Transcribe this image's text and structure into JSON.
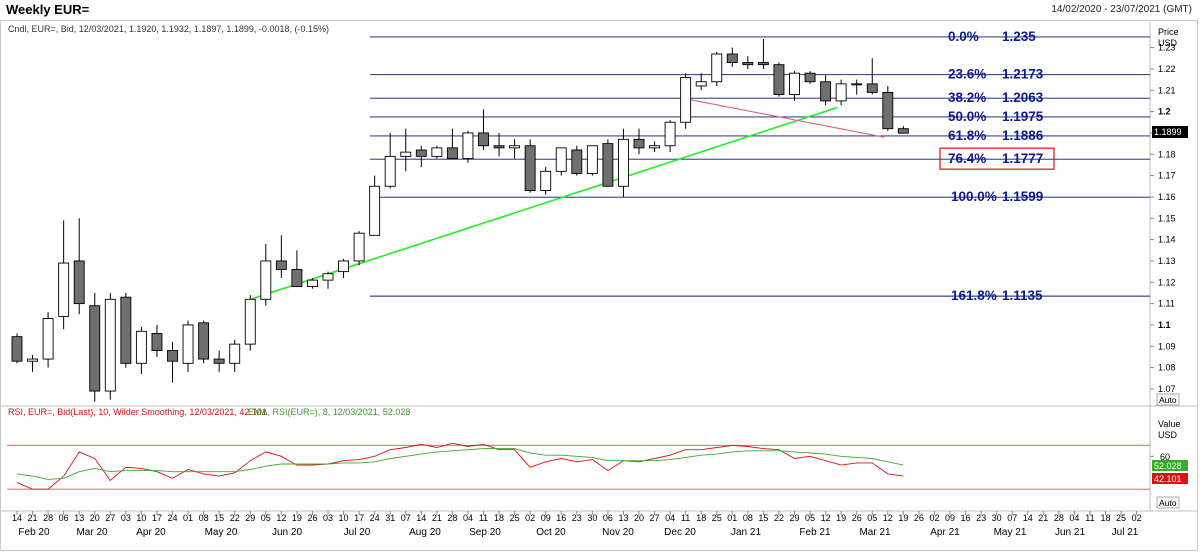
{
  "header": {
    "title": "Weekly EUR=",
    "date_range": "14/02/2020 - 23/07/2021 (GMT)"
  },
  "price_panel": {
    "legend": "Cndl, EUR=, Bid, 12/03/2021, 1.1920, 1.1932, 1.1897, 1.1899, -0.0018, (-0.15%)",
    "axis_title_1": "Price",
    "axis_title_2": "USD",
    "last_price_label": "1.1899",
    "auto_label": "Auto"
  },
  "rsi_panel": {
    "legend_rsi": "RSI, EUR=, Bid(Last),  10, Wilder Smoothing, 12/03/2021, 42.101",
    "legend_ema": "EMA, RSI(EUR=),  8, 12/03/2021, 52.028",
    "axis_title_1": "Value",
    "axis_title_2": "USD",
    "tick_60": "60",
    "ema_value_label": "52.028",
    "rsi_value_label": "42.101",
    "auto_label": "Auto"
  },
  "colors": {
    "up_body": "#ffffff",
    "down_body": "#6f6f6f",
    "fib_line": "#0a1470",
    "fib_label": "#0d1a8c",
    "trendline": "#22ee22",
    "downtrend": "#e0607a",
    "rsi_line": "#e01010",
    "ema_line": "#3caa2a",
    "highlight_box": "#e01010"
  },
  "chart_data": [
    {
      "type": "candlestick",
      "title": "Weekly EUR=",
      "ylabel": "Price USD",
      "ylim": [
        1.062,
        1.242
      ],
      "y_ticks": [
        1.07,
        1.08,
        1.09,
        1.1,
        1.11,
        1.12,
        1.13,
        1.14,
        1.15,
        1.16,
        1.17,
        1.18,
        1.19,
        1.2,
        1.21,
        1.22,
        1.23
      ],
      "y_tick_labels": [
        "1.07",
        "1.08",
        "1.09",
        "1.1",
        "1.11",
        "1.12",
        "1.13",
        "1.14",
        "1.15",
        "1.16",
        "1.17",
        "1.18",
        "1.19",
        "1.2",
        "1.21",
        "1.22",
        "1.23"
      ],
      "x_ticks": [
        "14",
        "21",
        "28",
        "06",
        "13",
        "20",
        "27",
        "03",
        "10",
        "17",
        "24",
        "01",
        "08",
        "15",
        "22",
        "29",
        "05",
        "12",
        "19",
        "26",
        "03",
        "10",
        "17",
        "24",
        "31",
        "07",
        "14",
        "21",
        "28",
        "04",
        "11",
        "18",
        "25",
        "02",
        "09",
        "16",
        "23",
        "30",
        "06",
        "13",
        "20",
        "27",
        "04",
        "11",
        "18",
        "25",
        "01",
        "08",
        "15",
        "22",
        "29",
        "05",
        "12",
        "19",
        "26",
        "05",
        "12",
        "19",
        "26",
        "02",
        "09",
        "16",
        "23",
        "30",
        "07",
        "14",
        "21",
        "28",
        "04",
        "11",
        "18",
        "25",
        "02",
        "09",
        "16",
        "23"
      ],
      "month_labels": [
        "Feb 20",
        "Mar 20",
        "Apr 20",
        "May 20",
        "Jun 20",
        "Jul 20",
        "Aug 20",
        "Sep 20",
        "Oct 20",
        "Nov 20",
        "Dec 20",
        "Jan 21",
        "Feb 21",
        "Mar 21",
        "Apr 21",
        "May 21",
        "Jun 21",
        "Jul 21"
      ],
      "candles": [
        {
          "o": 1.0945,
          "h": 1.096,
          "l": 1.082,
          "c": 1.083
        },
        {
          "o": 1.083,
          "h": 1.086,
          "l": 1.078,
          "c": 1.084
        },
        {
          "o": 1.084,
          "h": 1.106,
          "l": 1.08,
          "c": 1.103
        },
        {
          "o": 1.104,
          "h": 1.149,
          "l": 1.098,
          "c": 1.129
        },
        {
          "o": 1.13,
          "h": 1.15,
          "l": 1.105,
          "c": 1.11
        },
        {
          "o": 1.109,
          "h": 1.115,
          "l": 1.064,
          "c": 1.069
        },
        {
          "o": 1.069,
          "h": 1.115,
          "l": 1.065,
          "c": 1.112
        },
        {
          "o": 1.113,
          "h": 1.115,
          "l": 1.08,
          "c": 1.082
        },
        {
          "o": 1.082,
          "h": 1.099,
          "l": 1.077,
          "c": 1.097
        },
        {
          "o": 1.096,
          "h": 1.1,
          "l": 1.085,
          "c": 1.088
        },
        {
          "o": 1.088,
          "h": 1.092,
          "l": 1.073,
          "c": 1.083
        },
        {
          "o": 1.082,
          "h": 1.102,
          "l": 1.078,
          "c": 1.1
        },
        {
          "o": 1.101,
          "h": 1.102,
          "l": 1.082,
          "c": 1.084
        },
        {
          "o": 1.084,
          "h": 1.088,
          "l": 1.078,
          "c": 1.082
        },
        {
          "o": 1.082,
          "h": 1.093,
          "l": 1.078,
          "c": 1.091
        },
        {
          "o": 1.091,
          "h": 1.114,
          "l": 1.088,
          "c": 1.112
        },
        {
          "o": 1.112,
          "h": 1.138,
          "l": 1.109,
          "c": 1.13
        },
        {
          "o": 1.13,
          "h": 1.142,
          "l": 1.122,
          "c": 1.126
        },
        {
          "o": 1.126,
          "h": 1.135,
          "l": 1.118,
          "c": 1.118
        },
        {
          "o": 1.118,
          "h": 1.122,
          "l": 1.117,
          "c": 1.121
        },
        {
          "o": 1.121,
          "h": 1.125,
          "l": 1.117,
          "c": 1.124
        },
        {
          "o": 1.125,
          "h": 1.131,
          "l": 1.122,
          "c": 1.13
        },
        {
          "o": 1.13,
          "h": 1.144,
          "l": 1.128,
          "c": 1.143
        },
        {
          "o": 1.142,
          "h": 1.17,
          "l": 1.142,
          "c": 1.165
        },
        {
          "o": 1.165,
          "h": 1.19,
          "l": 1.164,
          "c": 1.179
        },
        {
          "o": 1.179,
          "h": 1.192,
          "l": 1.172,
          "c": 1.181
        },
        {
          "o": 1.182,
          "h": 1.184,
          "l": 1.174,
          "c": 1.179
        },
        {
          "o": 1.179,
          "h": 1.184,
          "l": 1.178,
          "c": 1.183
        },
        {
          "o": 1.183,
          "h": 1.192,
          "l": 1.178,
          "c": 1.178
        },
        {
          "o": 1.178,
          "h": 1.191,
          "l": 1.176,
          "c": 1.19
        },
        {
          "o": 1.19,
          "h": 1.201,
          "l": 1.182,
          "c": 1.184
        },
        {
          "o": 1.184,
          "h": 1.19,
          "l": 1.179,
          "c": 1.183
        },
        {
          "o": 1.183,
          "h": 1.187,
          "l": 1.178,
          "c": 1.184
        },
        {
          "o": 1.184,
          "h": 1.187,
          "l": 1.162,
          "c": 1.163
        },
        {
          "o": 1.163,
          "h": 1.174,
          "l": 1.161,
          "c": 1.172
        },
        {
          "o": 1.172,
          "h": 1.183,
          "l": 1.17,
          "c": 1.183
        },
        {
          "o": 1.182,
          "h": 1.184,
          "l": 1.17,
          "c": 1.171
        },
        {
          "o": 1.171,
          "h": 1.184,
          "l": 1.17,
          "c": 1.184
        },
        {
          "o": 1.185,
          "h": 1.187,
          "l": 1.165,
          "c": 1.165
        },
        {
          "o": 1.165,
          "h": 1.192,
          "l": 1.16,
          "c": 1.187
        },
        {
          "o": 1.187,
          "h": 1.192,
          "l": 1.18,
          "c": 1.183
        },
        {
          "o": 1.183,
          "h": 1.186,
          "l": 1.181,
          "c": 1.184
        },
        {
          "o": 1.184,
          "h": 1.196,
          "l": 1.181,
          "c": 1.195
        },
        {
          "o": 1.195,
          "h": 1.218,
          "l": 1.192,
          "c": 1.216
        },
        {
          "o": 1.212,
          "h": 1.218,
          "l": 1.21,
          "c": 1.214
        },
        {
          "o": 1.214,
          "h": 1.228,
          "l": 1.212,
          "c": 1.227
        },
        {
          "o": 1.227,
          "h": 1.23,
          "l": 1.221,
          "c": 1.223
        },
        {
          "o": 1.223,
          "h": 1.226,
          "l": 1.22,
          "c": 1.222
        },
        {
          "o": 1.223,
          "h": 1.234,
          "l": 1.22,
          "c": 1.222
        },
        {
          "o": 1.222,
          "h": 1.223,
          "l": 1.207,
          "c": 1.208
        },
        {
          "o": 1.208,
          "h": 1.219,
          "l": 1.205,
          "c": 1.218
        },
        {
          "o": 1.218,
          "h": 1.219,
          "l": 1.213,
          "c": 1.214
        },
        {
          "o": 1.214,
          "h": 1.217,
          "l": 1.203,
          "c": 1.205
        },
        {
          "o": 1.205,
          "h": 1.215,
          "l": 1.203,
          "c": 1.213
        },
        {
          "o": 1.213,
          "h": 1.215,
          "l": 1.208,
          "c": 1.213
        },
        {
          "o": 1.213,
          "h": 1.225,
          "l": 1.208,
          "c": 1.209
        },
        {
          "o": 1.209,
          "h": 1.212,
          "l": 1.191,
          "c": 1.192
        },
        {
          "o": 1.192,
          "h": 1.1932,
          "l": 1.1897,
          "c": 1.1899
        }
      ],
      "fibonacci_levels": [
        {
          "label": "0.0%",
          "value_label": "1.235",
          "value": 1.235
        },
        {
          "label": "23.6%",
          "value_label": "1.2173",
          "value": 1.2173
        },
        {
          "label": "38.2%",
          "value_label": "1.2063",
          "value": 1.2063
        },
        {
          "label": "50.0%",
          "value_label": "1.1975",
          "value": 1.1975
        },
        {
          "label": "61.8%",
          "value_label": "1.1886",
          "value": 1.1886
        },
        {
          "label": "76.4%",
          "value_label": "1.1777",
          "value": 1.1777,
          "highlight": true
        },
        {
          "label": "100.0%",
          "value_label": "1.1599",
          "value": 1.1599
        },
        {
          "label": "161.8%",
          "value_label": "1.1135",
          "value": 1.1135
        }
      ],
      "trendlines": [
        {
          "name": "support",
          "from": {
            "bar": 15,
            "y": 1.112
          },
          "to": {
            "bar": 52,
            "y": 1.202
          }
        },
        {
          "name": "resistance",
          "from": {
            "bar": 43,
            "y": 1.206
          },
          "to": {
            "bar": 55,
            "y": 1.188
          }
        }
      ]
    },
    {
      "type": "line",
      "ylabel": "Value USD",
      "ylim": [
        22,
        84
      ],
      "reference_lines": [
        70,
        30
      ],
      "y_tick_labels": [
        "60"
      ],
      "series": [
        {
          "name": "RSI",
          "values": [
            36,
            30,
            30,
            42,
            64,
            58,
            38,
            50,
            49,
            46,
            40,
            48,
            44,
            42,
            45,
            56,
            64,
            60,
            52,
            52,
            53,
            56,
            57,
            60,
            66,
            68,
            71,
            68,
            72,
            69,
            71,
            66,
            66,
            50,
            55,
            58,
            55,
            57,
            47,
            56,
            55,
            58,
            61,
            66,
            66,
            68,
            70,
            69,
            67,
            66,
            58,
            60,
            56,
            52,
            54,
            54,
            44,
            42
          ]
        },
        {
          "name": "EMA",
          "values": [
            44,
            42,
            39,
            40,
            46,
            49,
            46,
            47,
            47,
            47,
            46,
            46,
            46,
            46,
            46,
            48,
            51,
            53,
            53,
            53,
            53,
            54,
            54,
            55,
            58,
            60,
            62,
            64,
            65,
            66,
            67,
            67,
            67,
            63,
            61,
            61,
            60,
            59,
            56,
            56,
            56,
            56,
            57,
            59,
            61,
            62,
            64,
            65,
            65,
            65,
            64,
            63,
            62,
            60,
            59,
            58,
            55,
            52
          ]
        }
      ]
    }
  ]
}
